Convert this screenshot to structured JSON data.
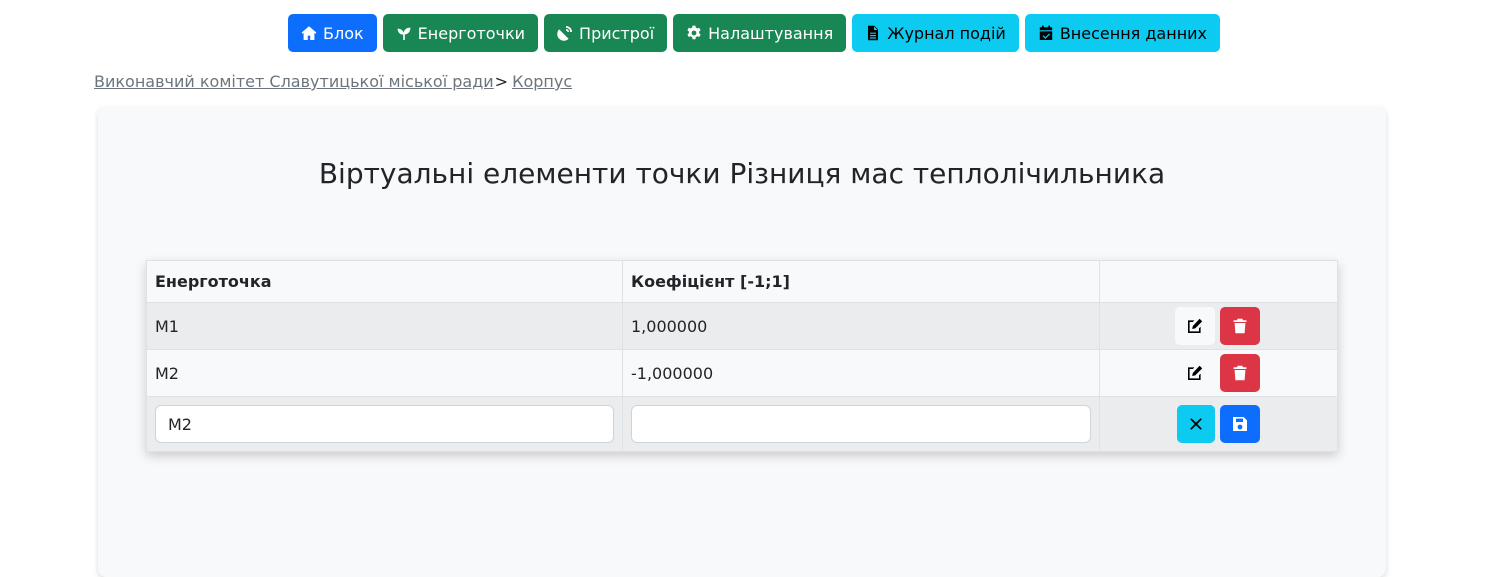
{
  "nav": [
    {
      "label": "Блок",
      "icon": "home-icon",
      "style": "primary"
    },
    {
      "label": "Енерготочки",
      "icon": "sprout-icon",
      "style": "success"
    },
    {
      "label": "Пристрої",
      "icon": "satellite-dish-icon",
      "style": "success"
    },
    {
      "label": "Налаштування",
      "icon": "gear-icon",
      "style": "success"
    },
    {
      "label": "Журнал подій",
      "icon": "file-icon",
      "style": "info"
    },
    {
      "label": "Внесення данних",
      "icon": "calendar-check-icon",
      "style": "info"
    }
  ],
  "breadcrumb": {
    "items": [
      "Виконавчий комітет Славутицької міської ради",
      "Корпус"
    ],
    "separator": ">"
  },
  "page": {
    "title": "Віртуальні елементи точки Різниця мас теплолічильника"
  },
  "table": {
    "headers": [
      "Енерготочка",
      "Коефіцієнт [-1;1]",
      ""
    ],
    "rows": [
      {
        "point": "М1",
        "coefficient": "1,000000"
      },
      {
        "point": "М2",
        "coefficient": "-1,000000"
      }
    ],
    "edit_row": {
      "point_value": "М2",
      "coefficient_value": ""
    }
  },
  "colors": {
    "primary": "#0d6efd",
    "success": "#198754",
    "info": "#0dcaf0",
    "danger": "#dc3545"
  }
}
